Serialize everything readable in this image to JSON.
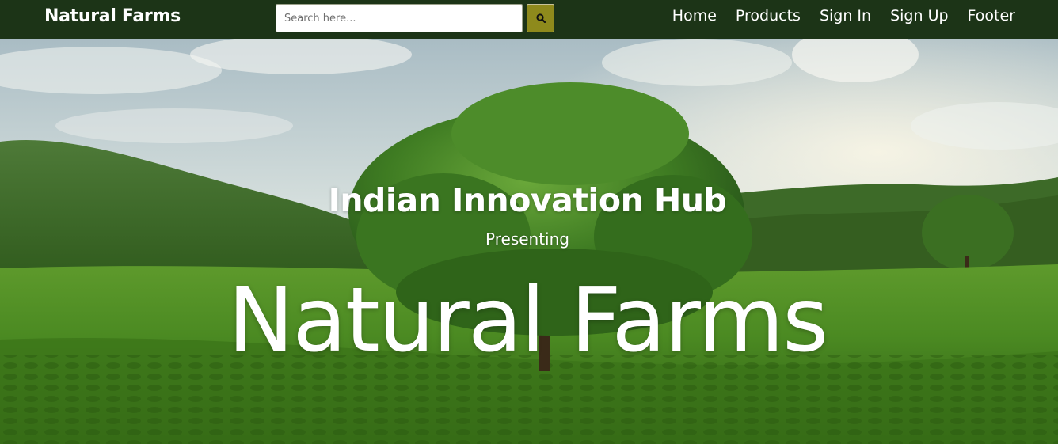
{
  "navbar": {
    "brand": "Natural Farms",
    "search": {
      "placeholder": "Search here...",
      "value": "",
      "button_icon": "search-icon"
    },
    "links": [
      {
        "label": "Home"
      },
      {
        "label": "Products"
      },
      {
        "label": "Sign In"
      },
      {
        "label": "Sign Up"
      },
      {
        "label": "Footer"
      }
    ]
  },
  "hero": {
    "subtitle": "Indian Innovation Hub",
    "kicker": "Presenting",
    "title": "Natural Farms"
  },
  "colors": {
    "navbar_bg": "#1c3417",
    "search_button_bg": "#8e8a1c",
    "text_primary": "#ffffff",
    "field_green": "#3f7a1e",
    "sky": "#dfe8e6"
  }
}
